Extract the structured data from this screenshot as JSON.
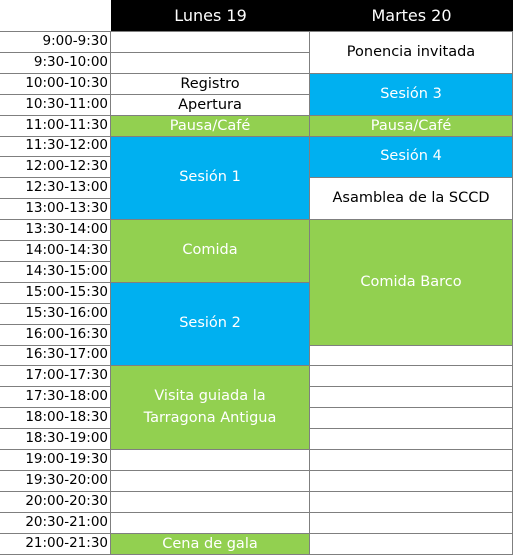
{
  "header": {
    "days": [
      "Lunes 19",
      "Martes 20"
    ]
  },
  "time_slots": [
    "9:00-9:30",
    "9:30-10:00",
    "10:00-10:30",
    "10:30-11:00",
    "11:00-11:30",
    "11:30-12:00",
    "12:00-12:30",
    "12:30-13:00",
    "13:00-13:30",
    "13:30-14:00",
    "14:00-14:30",
    "14:30-15:00",
    "15:00-15:30",
    "15:30-16:00",
    "16:00-16:30",
    "16:30-17:00",
    "17:00-17:30",
    "17:30-18:00",
    "18:00-18:30",
    "18:30-19:00",
    "19:00-19:30",
    "19:30-20:00",
    "20:00-20:30",
    "20:30-21:00",
    "21:00-21:30"
  ],
  "colors": {
    "blue": "#00b0f0",
    "green": "#92d050",
    "white": "#ffffff",
    "header": "#000000"
  },
  "events": [
    {
      "day": 0,
      "start": 2,
      "span": 1,
      "label": "Registro",
      "color": "white",
      "name": "event-registro"
    },
    {
      "day": 0,
      "start": 3,
      "span": 1,
      "label": "Apertura",
      "color": "white",
      "name": "event-apertura"
    },
    {
      "day": 0,
      "start": 4,
      "span": 1,
      "label": "Pausa/Café",
      "color": "green",
      "name": "event-pausa-cafe-lunes"
    },
    {
      "day": 0,
      "start": 5,
      "span": 4,
      "label": "Sesión 1",
      "color": "blue",
      "name": "event-sesion-1"
    },
    {
      "day": 0,
      "start": 9,
      "span": 3,
      "label": "Comida",
      "color": "green",
      "name": "event-comida"
    },
    {
      "day": 0,
      "start": 12,
      "span": 4,
      "label": "Sesión 2",
      "color": "blue",
      "name": "event-sesion-2"
    },
    {
      "day": 0,
      "start": 16,
      "span": 4,
      "label": "Visita guiada la Tarragona Antigua",
      "color": "green",
      "name": "event-visita-guiada"
    },
    {
      "day": 0,
      "start": 24,
      "span": 1,
      "label": "Cena de gala",
      "color": "green",
      "name": "event-cena-de-gala"
    },
    {
      "day": 1,
      "start": 0,
      "span": 2,
      "label": "Ponencia invitada",
      "color": "white",
      "name": "event-ponencia-invitada"
    },
    {
      "day": 1,
      "start": 2,
      "span": 2,
      "label": "Sesión 3",
      "color": "blue",
      "name": "event-sesion-3"
    },
    {
      "day": 1,
      "start": 4,
      "span": 1,
      "label": "Pausa/Café",
      "color": "green",
      "name": "event-pausa-cafe-martes"
    },
    {
      "day": 1,
      "start": 5,
      "span": 2,
      "label": "Sesión 4",
      "color": "blue",
      "name": "event-sesion-4"
    },
    {
      "day": 1,
      "start": 7,
      "span": 2,
      "label": "Asamblea de la SCCD",
      "color": "white",
      "name": "event-asamblea-sccd"
    },
    {
      "day": 1,
      "start": 9,
      "span": 6,
      "label": "Comida Barco",
      "color": "green",
      "name": "event-comida-barco"
    }
  ]
}
